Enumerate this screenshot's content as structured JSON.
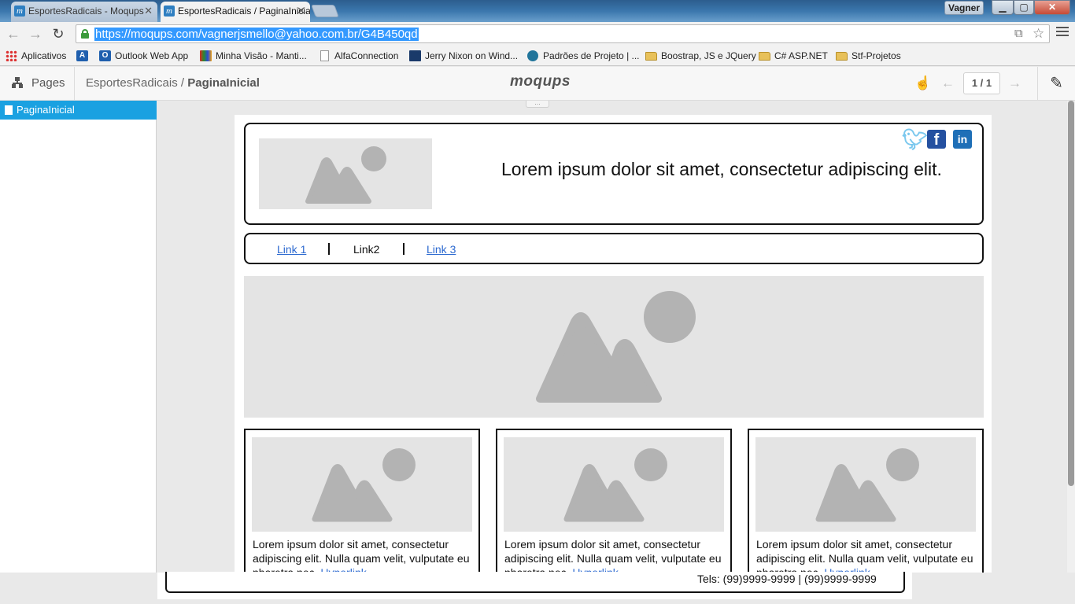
{
  "browser": {
    "tabs": [
      {
        "title": "EsportesRadicais - Moqups",
        "active": false
      },
      {
        "title": "EsportesRadicais / PaginaInicial",
        "active": true
      }
    ],
    "user": "Vagner",
    "url": "https://moqups.com/vagnerjsmello@yahoo.com.br/G4B450qd",
    "bookmarks": [
      {
        "label": "Aplicativos",
        "icon": "apps-grid-icon"
      },
      {
        "label": "",
        "icon": "translate-icon"
      },
      {
        "label": "Outlook Web App",
        "icon": "outlook-icon"
      },
      {
        "label": "Minha Visão - Manti...",
        "icon": "mantis-icon"
      },
      {
        "label": "AlfaConnection",
        "icon": "page-icon"
      },
      {
        "label": "Jerry Nixon on Wind...",
        "icon": "blog-icon"
      },
      {
        "label": "Padrões de Projeto | ...",
        "icon": "wordpress-icon"
      },
      {
        "label": "Boostrap, JS e JQuery",
        "icon": "folder-icon"
      },
      {
        "label": "C# ASP.NET",
        "icon": "folder-icon"
      },
      {
        "label": "Stf-Projetos",
        "icon": "folder-icon"
      }
    ]
  },
  "app": {
    "pages_label": "Pages",
    "breadcrumb_project": "EsportesRadicais /",
    "breadcrumb_page": "PaginaInicial",
    "brand": "moqups",
    "page_counter": "1 / 1",
    "sidebar_pages": [
      "PaginaInicial"
    ]
  },
  "mockup": {
    "header_text": "Lorem ipsum dolor sit amet, consectetur adipiscing elit.",
    "nav_links": [
      "Link 1",
      "Link2",
      "Link 3"
    ],
    "cards": [
      {
        "text": "Lorem ipsum dolor sit amet, consectetur adipiscing elit. Nulla quam velit, vulputate eu pharetra nec, ",
        "link": "Hyperlink"
      },
      {
        "text": "Lorem ipsum dolor sit amet, consectetur adipiscing elit. Nulla quam velit, vulputate eu pharetra nec, ",
        "link": "Hyperlink"
      },
      {
        "text": "Lorem ipsum dolor sit amet, consectetur adipiscing elit. Nulla quam velit, vulputate eu pharetra nec, ",
        "link": "Hyperlink"
      }
    ],
    "footer_text": "Tels: (99)9999-9999 | (99)9999-9999"
  },
  "colors": {
    "selection": "#1aa1e1",
    "link": "#2d6ad0",
    "placeholder": "#e4e4e4",
    "placeholder_shape": "#b3b3b3"
  }
}
